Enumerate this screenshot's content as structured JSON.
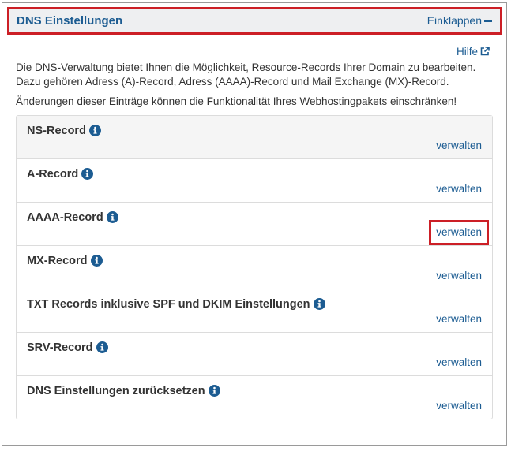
{
  "panel": {
    "title": "DNS Einstellungen",
    "collapse_label": "Einklappen",
    "help_label": "Hilfe",
    "intro": "Die DNS-Verwaltung bietet Ihnen die Möglichkeit, Resource-Records Ihrer Domain zu bearbeiten. Dazu gehören Adress (A)-Record, Adress (AAAA)-Record und Mail Exchange (MX)-Record.",
    "warning": "Änderungen dieser Einträge können die Funktionalität Ihres Webhostingpakets einschränken!"
  },
  "records": [
    {
      "title": "NS-Record",
      "action": "verwalten"
    },
    {
      "title": "A-Record",
      "action": "verwalten"
    },
    {
      "title": "AAAA-Record",
      "action": "verwalten"
    },
    {
      "title": "MX-Record",
      "action": "verwalten"
    },
    {
      "title": "TXT Records inklusive SPF und DKIM Einstellungen",
      "action": "verwalten"
    },
    {
      "title": "SRV-Record",
      "action": "verwalten"
    },
    {
      "title": "DNS Einstellungen zurücksetzen",
      "action": "verwalten"
    }
  ],
  "colors": {
    "accent": "#1c5c92",
    "highlight": "#cc1f26",
    "header_bg": "#eeeff1"
  }
}
